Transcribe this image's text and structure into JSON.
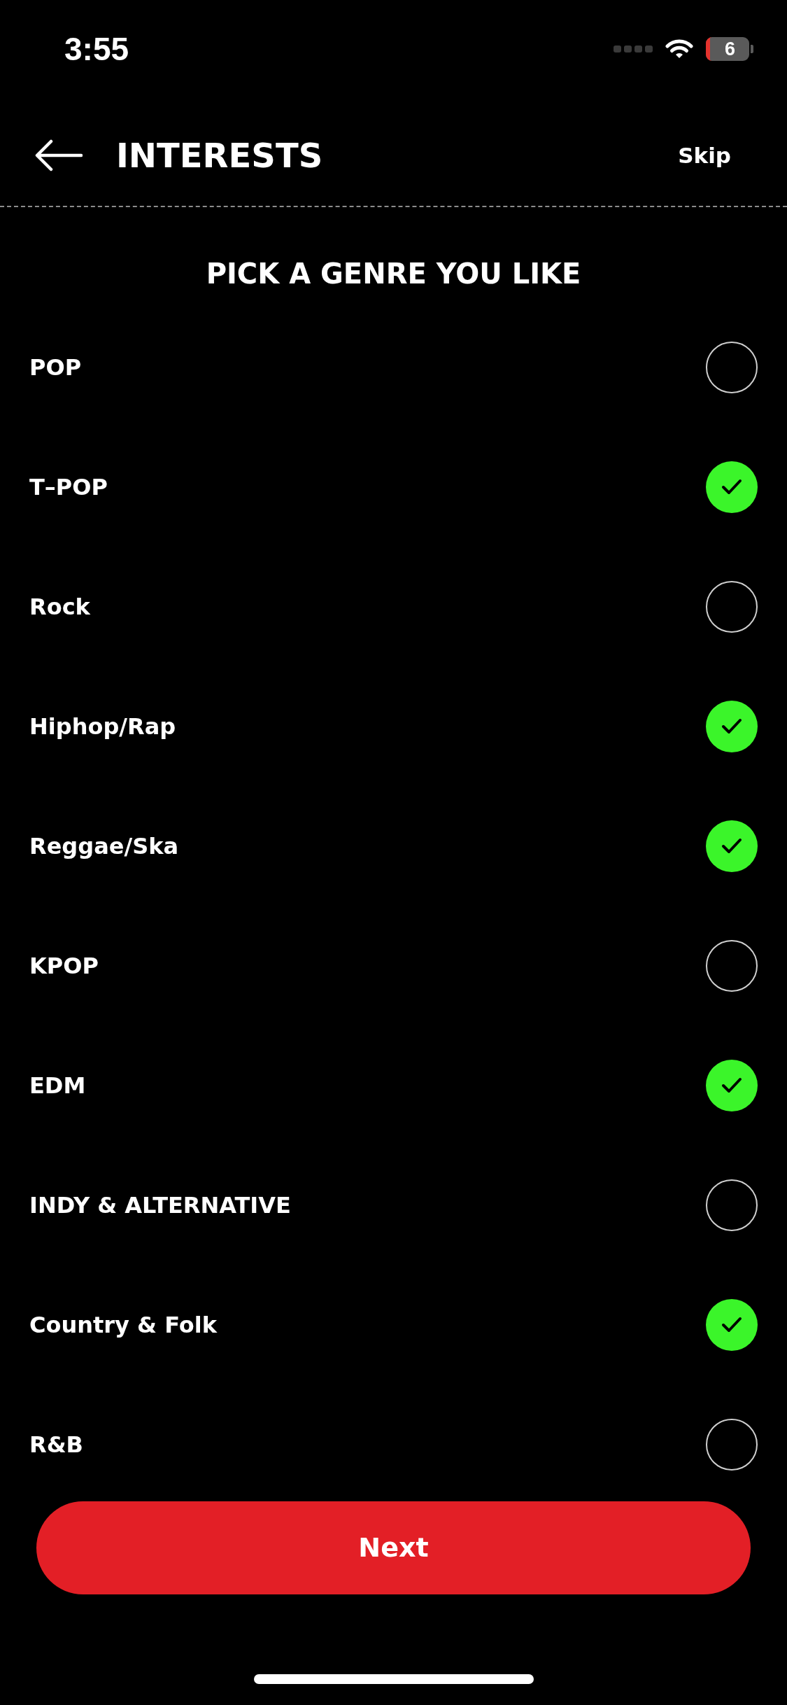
{
  "status_bar": {
    "time": "3:55",
    "battery": "6"
  },
  "header": {
    "title": "INTERESTS",
    "skip": "Skip"
  },
  "prompt": "PICK A GENRE YOU LIKE",
  "genres": [
    {
      "label": "POP",
      "checked": false
    },
    {
      "label": "T–POP",
      "checked": true
    },
    {
      "label": "Rock",
      "checked": false
    },
    {
      "label": "Hiphop/Rap",
      "checked": true
    },
    {
      "label": "Reggae/Ska",
      "checked": true
    },
    {
      "label": "KPOP",
      "checked": false
    },
    {
      "label": "EDM",
      "checked": true
    },
    {
      "label": "INDY & ALTERNATIVE",
      "checked": false
    },
    {
      "label": "Country & Folk",
      "checked": true
    },
    {
      "label": "R&B",
      "checked": false
    }
  ],
  "next_button": "Next"
}
